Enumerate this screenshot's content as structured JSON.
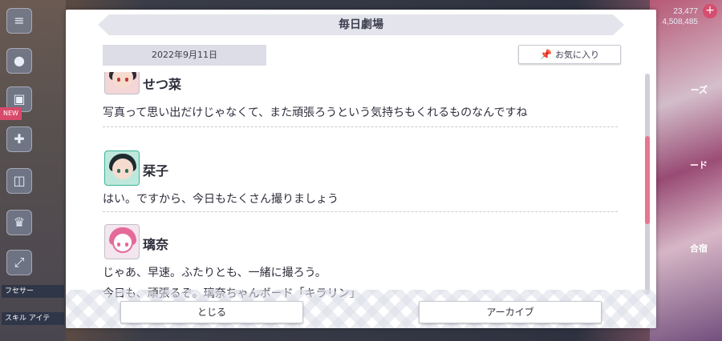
{
  "dialog": {
    "title": "毎日劇場",
    "date": "2022年9月11日",
    "favorite_label": "お気に入り",
    "close_label": "とじる",
    "archive_label": "アーカイブ"
  },
  "entries": [
    {
      "speaker": "せつ菜",
      "lines": [
        "写真って思い出だけじゃなくて、また頑張ろうという気持ちもくれるものなんですね"
      ]
    },
    {
      "speaker": "栞子",
      "lines": [
        "はい。ですから、今日もたくさん撮りましょう"
      ]
    },
    {
      "speaker": "璃奈",
      "lines": [
        "じゃあ、早速。ふたりとも、一緒に撮ろう。",
        "今日も、頑張るぞ。璃奈ちゃんボード「キラリン」"
      ]
    }
  ],
  "colors": {
    "accent": "#e8758f",
    "title_bg": "#e4e5ec",
    "avatar_setsuna": "#d9534f",
    "avatar_shioriko": "#3bb59a",
    "avatar_rina": "#b0b0c0"
  },
  "scroll": {
    "position_fraction": 0.47
  },
  "background": {
    "stats_top": "23,477",
    "stats_bottom": "4,508,485",
    "right_label_1": "ーズ",
    "right_label_2": "ード",
    "right_label_3": "合宿",
    "left_tag": "NEW",
    "left_label_1": "フセサー",
    "left_label_2": "スキル アイテ"
  },
  "icons": {
    "pin": "pin-icon",
    "menu": "menu-icon",
    "chat": "chat-icon",
    "gift": "gift-icon",
    "trophy": "trophy-icon",
    "fullscreen": "fullscreen-icon"
  }
}
